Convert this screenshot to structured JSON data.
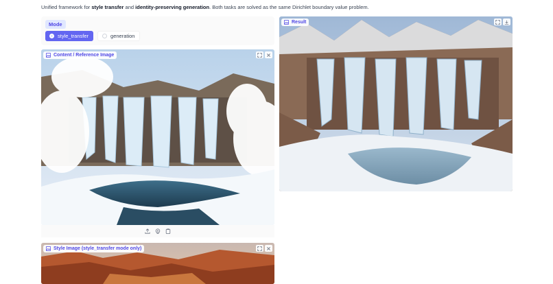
{
  "intro": {
    "prefix": "Unified framework for ",
    "term1": "style transfer",
    "middle": " and ",
    "term2": "identity-preserving generation",
    "suffix": ". Both tasks are solved as the same Dirichlet boundary value problem."
  },
  "mode": {
    "label": "Mode",
    "options": [
      "style_transfer",
      "generation"
    ],
    "selected": "style_transfer"
  },
  "panels": {
    "content_label": "Content / Reference Image",
    "result_label": "Result",
    "style_label": "Style Image (style_transfer mode only)"
  },
  "icons": {
    "image": "image-icon",
    "fullscreen": "fullscreen-icon",
    "close": "close-icon",
    "download": "download-icon",
    "upload": "upload-icon",
    "webcam": "webcam-icon",
    "clipboard": "clipboard-icon"
  },
  "colors": {
    "accent": "#6366f1",
    "accent_text": "#4f46e5",
    "accent_light": "#e0e7ff"
  }
}
